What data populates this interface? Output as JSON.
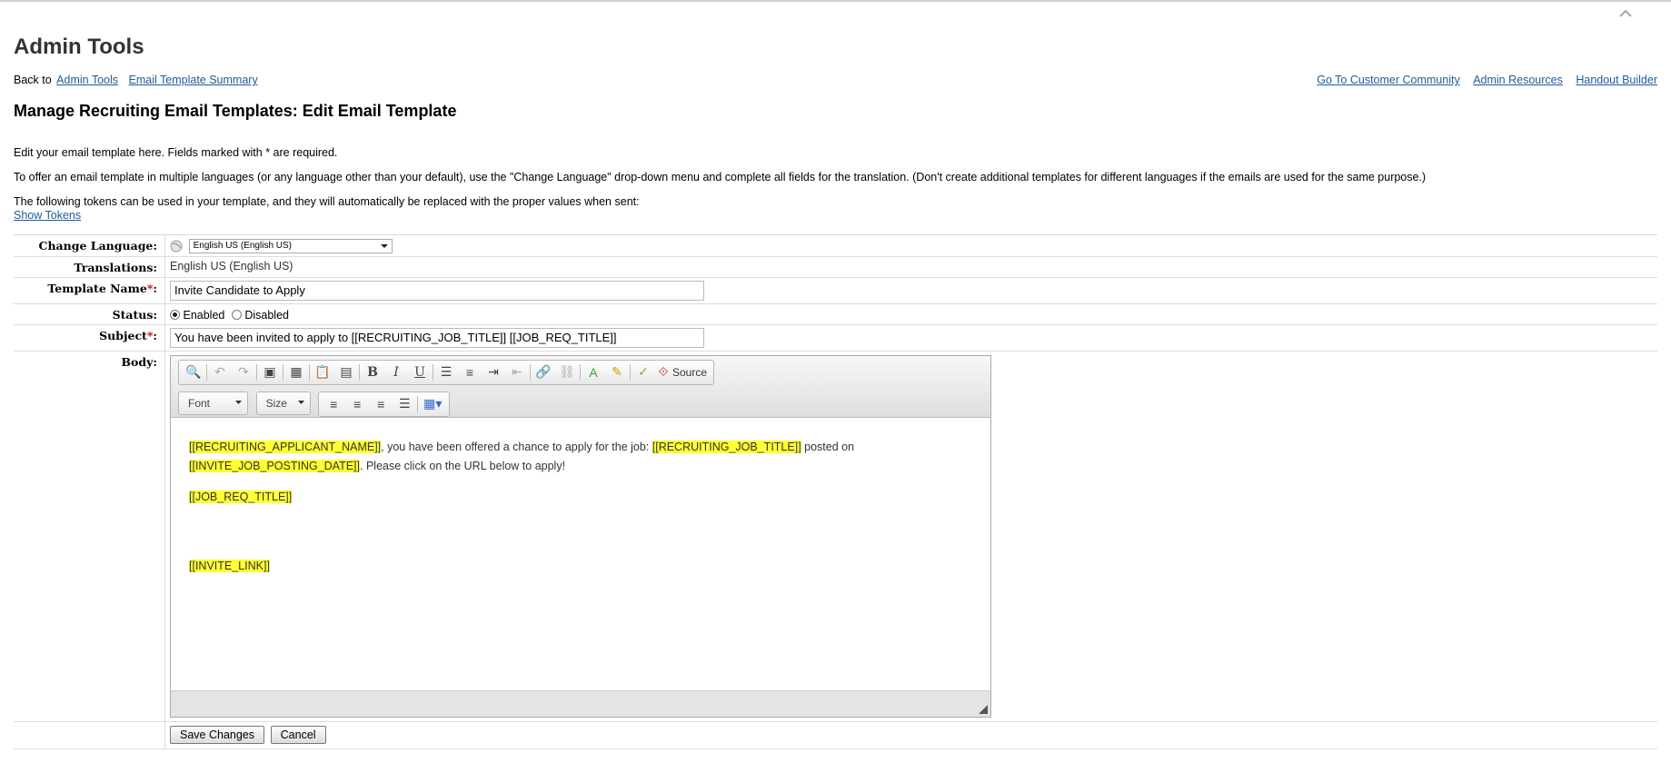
{
  "header": {
    "title": "Admin Tools",
    "back_prefix": "Back to",
    "back_links": [
      "Admin Tools",
      "Email Template Summary"
    ],
    "right_links": [
      "Go To Customer Community",
      "Admin Resources",
      "Handout Builder"
    ]
  },
  "page": {
    "heading": "Manage Recruiting Email Templates: Edit Email Template",
    "intro_1": "Edit your email template here. Fields marked with * are required.",
    "intro_2": "To offer an email template in multiple languages (or any language other than your default), use the \"Change Language\" drop-down menu and complete all fields for the translation. (Don't create additional templates for different languages if the emails are used for the same purpose.)",
    "intro_3": "The following tokens can be used in your template, and they will automatically be replaced with the proper values when sent:",
    "show_tokens": "Show Tokens"
  },
  "form": {
    "change_language_label": "Change Language:",
    "change_language_value": "English US (English US)",
    "translations_label": "Translations:",
    "translations_value": "English US (English US)",
    "template_name_label": "Template Name",
    "template_name_value": "Invite Candidate to Apply",
    "status_label": "Status:",
    "status_enabled": "Enabled",
    "status_disabled": "Disabled",
    "subject_label": "Subject",
    "subject_value": "You have been invited to apply to [[RECRUITING_JOB_TITLE]] [[JOB_REQ_TITLE]]",
    "body_label": "Body:",
    "required_mark": "*",
    "colon": ":"
  },
  "editor": {
    "source_label": "Source",
    "font_label": "Font",
    "size_label": "Size",
    "content": {
      "token_applicant": "[[RECRUITING_APPLICANT_NAME]]",
      "text_1": ", you have been offered a chance to apply for the job: ",
      "token_job_title": "[[RECRUITING_JOB_TITLE]]",
      "text_2": " posted on",
      "token_posting_date": "[[INVITE_JOB_POSTING_DATE]]",
      "text_3": ". Please click on the URL below to apply!",
      "token_req_title": "[[JOB_REQ_TITLE]]",
      "token_invite_link": "[[INVITE_LINK]]"
    }
  },
  "actions": {
    "save": "Save Changes",
    "cancel": "Cancel"
  },
  "icons": {
    "collapse": "chevron-up-icon",
    "language": "globe-icon",
    "resize": "resize-grip-icon"
  }
}
